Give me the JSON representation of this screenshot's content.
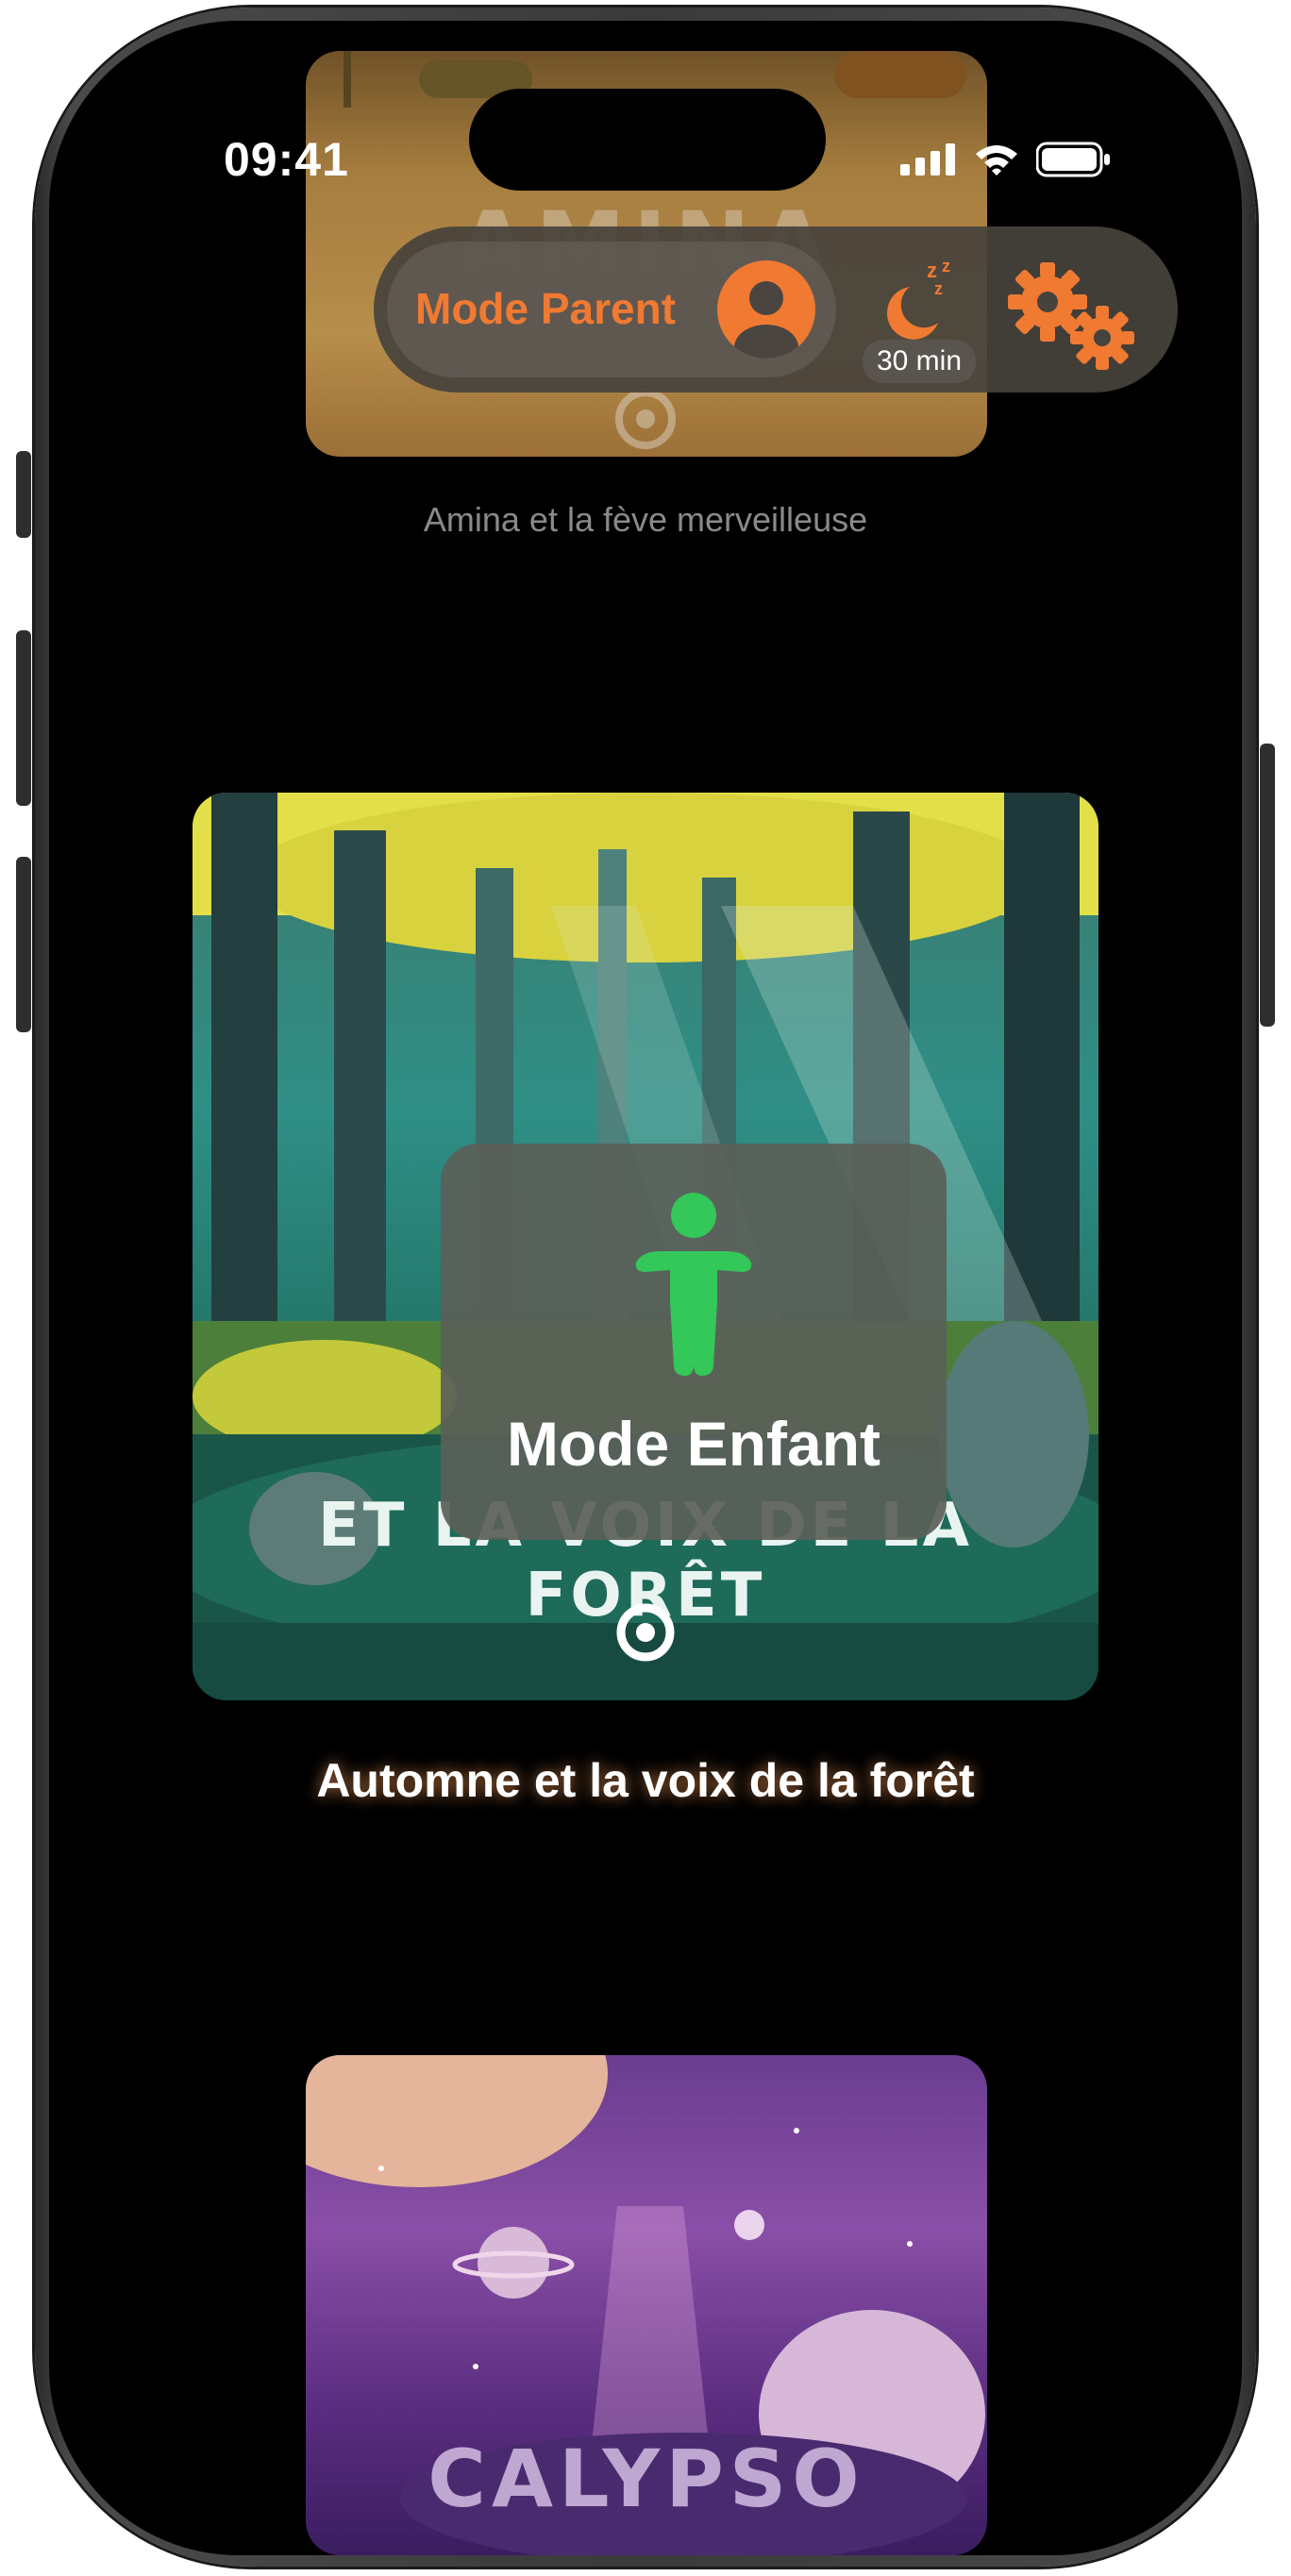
{
  "status_bar": {
    "time": "09:41"
  },
  "controls": {
    "parent_mode_label": "Mode Parent",
    "sleep_timer": "30 min"
  },
  "stories": [
    {
      "title": "Amina et la fève merveilleuse",
      "cover_text": "AMINA"
    },
    {
      "title": "Automne et la voix de la forêt",
      "cover_text": "ET LA VOIX DE LA FORÊT"
    },
    {
      "title": "Calypso",
      "cover_text": "CALYPSO"
    }
  ],
  "child_mode": {
    "label": "Mode Enfant"
  },
  "colors": {
    "accent": "#f07a32",
    "child_green": "#34c759",
    "caption_glow": "#ffa05a"
  },
  "icons": [
    "signal-icon",
    "wifi-icon",
    "battery-icon",
    "user-icon",
    "moon-sleep-icon",
    "settings-gears-icon",
    "child-figure-icon",
    "play-target-icon"
  ]
}
